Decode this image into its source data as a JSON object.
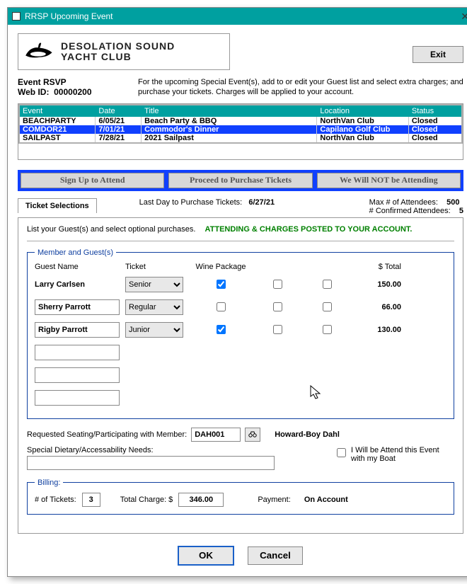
{
  "window": {
    "title": "RRSP Upcoming Event"
  },
  "header": {
    "brand_line1": "DESOLATION SOUND",
    "brand_line2": "YACHT CLUB",
    "exit": "Exit"
  },
  "rsvp": {
    "label": "Event RSVP",
    "webid_label": "Web ID:",
    "webid_value": "00000200",
    "blurb": "For the upcoming Special Event(s), add to or edit your Guest list and select extra charges; and purchase your tickets.  Charges will be applied to your account."
  },
  "event_table": {
    "headers": {
      "event": "Event",
      "date": "Date",
      "title": "Title",
      "location": "Location",
      "status": "Status"
    },
    "rows": [
      {
        "event": "BEACHPARTY",
        "date": "6/05/21",
        "title": "Beach Party & BBQ",
        "location": "NorthVan Club",
        "status": "Closed",
        "selected": false
      },
      {
        "event": "COMDOR21",
        "date": "7/01/21",
        "title": "Commodor's Dinner",
        "location": "Capilano Golf Club",
        "status": "Closed",
        "selected": true
      },
      {
        "event": "SAILPAST",
        "date": "7/28/21",
        "title": "2021 Sailpast",
        "location": "NorthVan Club",
        "status": "Closed",
        "selected": false
      }
    ]
  },
  "action_buttons": {
    "signup": "Sign Up to Attend",
    "purchase": "Proceed to Purchase Tickets",
    "notattend": "We Will NOT be Attending"
  },
  "meta": {
    "tab": "Ticket Selections",
    "lastday_label": "Last Day to Purchase Tickets:",
    "lastday_value": "6/27/21",
    "max_label": "Max # of Attendees:",
    "max_value": "500",
    "confirmed_label": "# Confirmed Attendees:",
    "confirmed_value": "5"
  },
  "panel": {
    "list_line": "List your Guest(s) and select optional purchases.",
    "attending_msg": "ATTENDING & CHARGES POSTED TO YOUR ACCOUNT."
  },
  "guests": {
    "legend": "Member and Guest(s)",
    "col_name": "Guest Name",
    "col_ticket": "Ticket",
    "col_wine": "Wine Package",
    "col_total": "$ Total",
    "ticket_options": [
      "Senior",
      "Regular",
      "Junior"
    ],
    "rows": [
      {
        "name": "Larry Carlsen",
        "name_editable": false,
        "ticket": "Senior",
        "wine": true,
        "c1": false,
        "c2": false,
        "total": "150.00"
      },
      {
        "name": "Sherry Parrott",
        "name_editable": true,
        "ticket": "Regular",
        "wine": false,
        "c1": false,
        "c2": false,
        "total": "66.00"
      },
      {
        "name": "Rigby Parrott",
        "name_editable": true,
        "ticket": "Junior",
        "wine": true,
        "c1": false,
        "c2": false,
        "total": "130.00"
      },
      {
        "name": "",
        "name_editable": true,
        "ticket": "",
        "wine": null,
        "c1": null,
        "c2": null,
        "total": ""
      },
      {
        "name": "",
        "name_editable": true,
        "ticket": "",
        "wine": null,
        "c1": null,
        "c2": null,
        "total": ""
      },
      {
        "name": "",
        "name_editable": true,
        "ticket": "",
        "wine": null,
        "c1": null,
        "c2": null,
        "total": ""
      }
    ]
  },
  "requested": {
    "label": "Requested Seating/Participating with  Member:",
    "code": "DAH001",
    "lookup_name": "Howard-Boy Dahl"
  },
  "special": {
    "label": "Special Dietary/Accessability Needs:",
    "value": ""
  },
  "boat": {
    "label": "I Will be Attend this Event with my Boat",
    "checked": false
  },
  "billing": {
    "legend": "Billing:",
    "tickets_label": "# of Tickets:",
    "tickets_value": "3",
    "total_label": "Total Charge:  $",
    "total_value": "346.00",
    "payment_label": "Payment:",
    "payment_value": "On Account"
  },
  "footer": {
    "ok": "OK",
    "cancel": "Cancel"
  }
}
